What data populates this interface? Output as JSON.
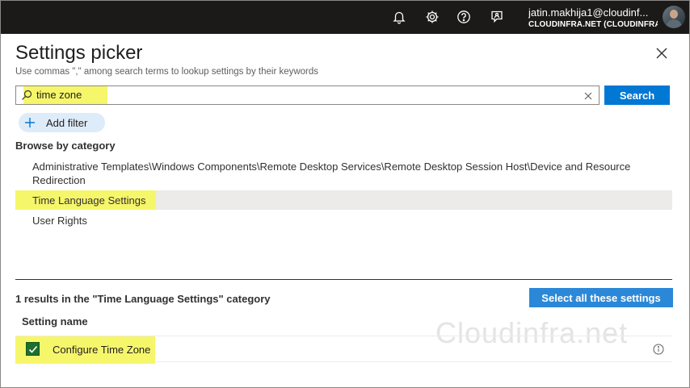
{
  "topbar": {
    "icons": [
      "bell-icon",
      "gear-icon",
      "help-icon",
      "feedback-icon"
    ],
    "user_name": "jatin.makhija1@cloudinf...",
    "tenant": "CLOUDINFRA.NET (CLOUDINFRA..."
  },
  "panel": {
    "title": "Settings picker",
    "subtitle": "Use commas \",\" among search terms to lookup settings by their keywords"
  },
  "search": {
    "value": "time zone",
    "button_label": "Search"
  },
  "add_filter_label": "Add filter",
  "browse": {
    "label": "Browse by category",
    "categories": [
      {
        "label": "Administrative Templates\\Windows Components\\Remote Desktop Services\\Remote Desktop Session Host\\Device and Resource Redirection"
      },
      {
        "label": "Time Language Settings",
        "selected": true
      },
      {
        "label": "User Rights"
      }
    ]
  },
  "results": {
    "label": "1 results in the \"Time Language Settings\" category",
    "select_all_label": "Select all these settings",
    "column_header": "Setting name",
    "rows": [
      {
        "name": "Configure Time Zone",
        "checked": true
      }
    ]
  },
  "watermark": "Cloudinfra.net",
  "colors": {
    "topbar": "#1b1a19",
    "primary_button": "#0078d4",
    "highlight": "#f6f66b",
    "checkbox": "#1e6e2e"
  }
}
